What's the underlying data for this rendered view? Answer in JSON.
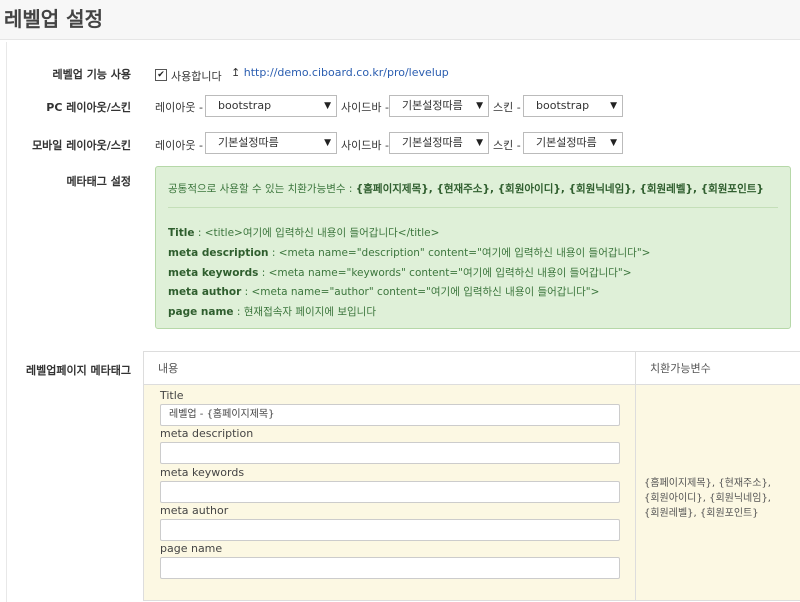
{
  "page": {
    "title": "레벨업 설정"
  },
  "levelup": {
    "label": "레벨업 기능 사용",
    "checkbox_label": "사용합니다",
    "link_arrow": "↥",
    "link": "http://demo.ciboard.co.kr/pro/levelup"
  },
  "pc": {
    "label": "PC 레이아웃/스킨",
    "layout_label": "레이아웃 -",
    "layout_value": "bootstrap",
    "sidebar_label": "사이드바 -",
    "sidebar_value": "기본설정따름",
    "skin_label": "스킨 -",
    "skin_value": "bootstrap"
  },
  "mobile": {
    "label": "모바일 레이아웃/스킨",
    "layout_label": "레이아웃 -",
    "layout_value": "기본설정따름",
    "sidebar_label": "사이드바 -",
    "sidebar_value": "기본설정따름",
    "skin_label": "스킨 -",
    "skin_value": "기본설정따름"
  },
  "metatag": {
    "label": "메타태그 설정",
    "common_prefix": "공통적으로 사용할 수 있는 치환가능변수 : ",
    "common_vars": "{홈페이지제목}, {현재주소}, {회원아이디}, {회원닉네임}, {회원레벨}, {회원포인트}",
    "lines": [
      {
        "key": "Title",
        "value": " : <title>여기에 입력하신 내용이 들어갑니다</title>"
      },
      {
        "key": "meta description",
        "value": " : <meta name=\"description\" content=\"여기에 입력하신 내용이 들어갑니다\">"
      },
      {
        "key": "meta keywords",
        "value": " : <meta name=\"keywords\" content=\"여기에 입력하신 내용이 들어갑니다\">"
      },
      {
        "key": "meta author",
        "value": " : <meta name=\"author\" content=\"여기에 입력하신 내용이 들어갑니다\">"
      },
      {
        "key": "page name",
        "value": " : 현재접속자 페이지에 보입니다"
      }
    ]
  },
  "page_meta": {
    "label": "레벨업페이지 메타태그",
    "col_content": "내용",
    "col_vars": "치환가능변수",
    "fields": [
      {
        "label": "Title",
        "value": "레벨업 - {홈페이지제목}"
      },
      {
        "label": "meta description",
        "value": ""
      },
      {
        "label": "meta keywords",
        "value": ""
      },
      {
        "label": "meta author",
        "value": ""
      },
      {
        "label": "page name",
        "value": ""
      }
    ],
    "vars_lines": [
      "{홈페이지제목}, {현재주소},",
      "{회원아이디}, {회원닉네임},",
      "{회원레벨}, {회원포인트}"
    ]
  },
  "icons": {
    "dropdown": "▼",
    "check": "✔"
  }
}
